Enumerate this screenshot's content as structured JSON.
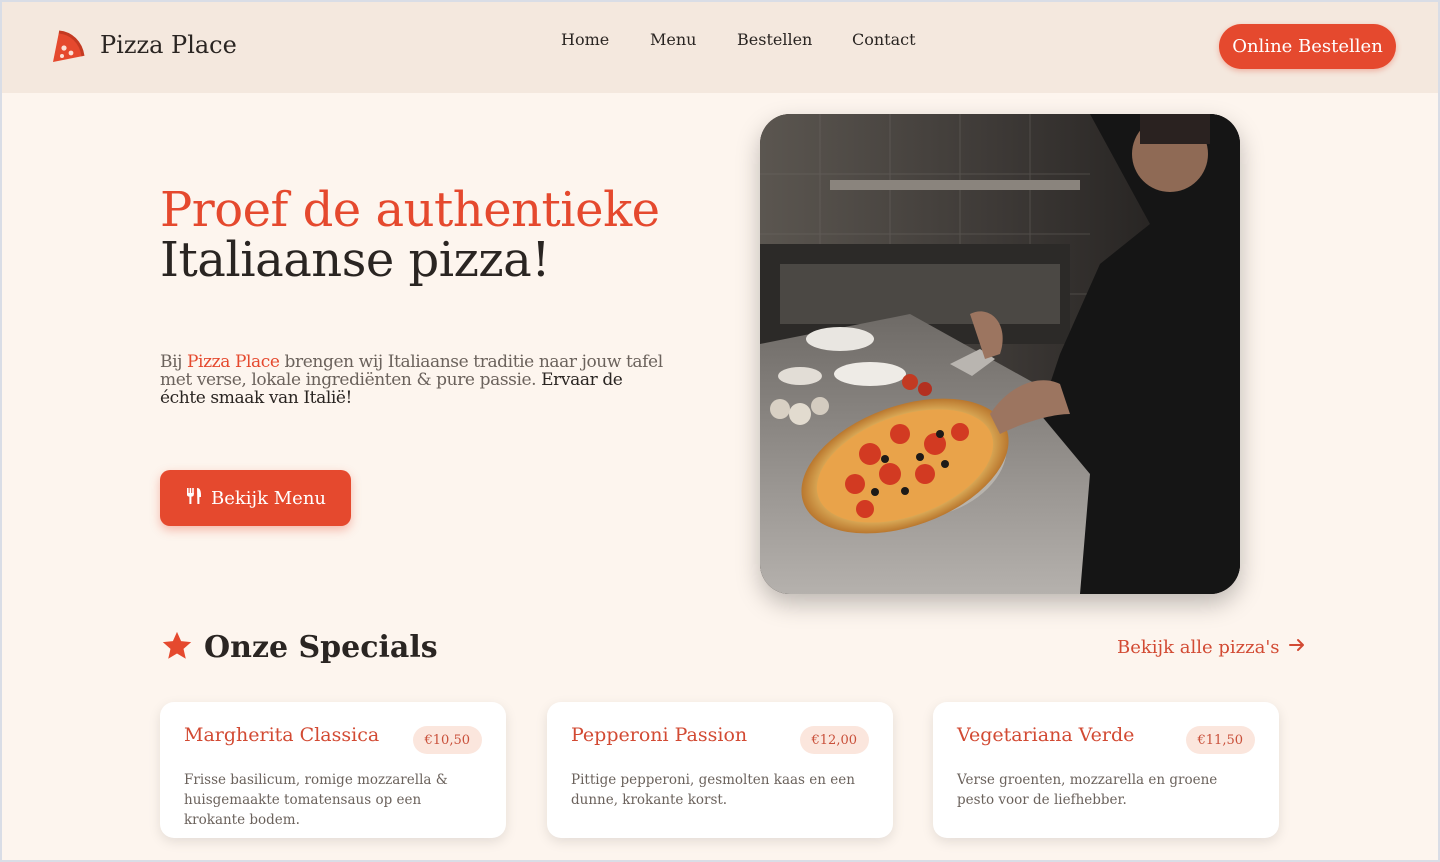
{
  "header": {
    "brand": "Pizza Place",
    "nav": [
      "Home",
      "Menu",
      "Bestellen",
      "Contact"
    ],
    "cta_label": "Online Bestellen"
  },
  "hero": {
    "title_line1": "Proef de authentieke",
    "title_line2": "Italiaanse pizza!",
    "text_prefix": "Bij ",
    "text_brand": "Pizza Place",
    "text_middle": " brengen wij Italiaanse traditie naar jouw tafel met verse, lokale ingrediënten & pure passie. ",
    "text_strong": "Ervaar de échte smaak van Italië!",
    "button_label": "Bekijk Menu"
  },
  "specials": {
    "title": "Onze Specials",
    "all_link": "Bekijk alle pizza's",
    "items": [
      {
        "name": "Margherita Classica",
        "price": "€10,50",
        "desc": "Frisse basilicum, romige mozzarella & huisgemaakte tomatensaus op een krokante bodem."
      },
      {
        "name": "Pepperoni Passion",
        "price": "€12,00",
        "desc": "Pittige pepperoni, gesmolten kaas en een dunne, krokante korst."
      },
      {
        "name": "Vegetariana Verde",
        "price": "€11,50",
        "desc": "Verse groenten, mozzarella en groene pesto voor de liefhebber."
      }
    ]
  },
  "colors": {
    "accent": "#e5492e",
    "header_bg": "#f4e8de",
    "page_bg": "#fdf5ee"
  },
  "icons": {
    "logo": "pizza-slice-icon",
    "menu_button": "utensils-icon",
    "specials": "star-icon",
    "all_link": "arrow-right-icon"
  }
}
